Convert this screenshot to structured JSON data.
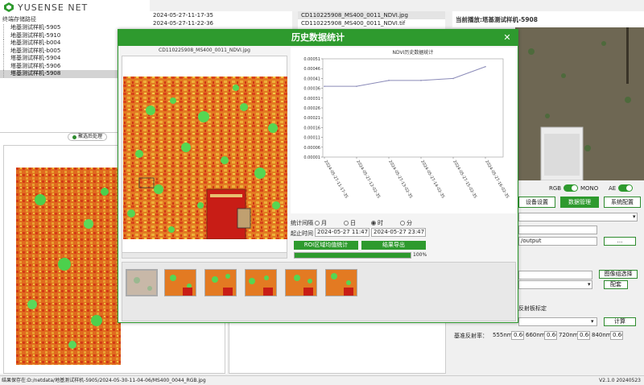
{
  "brand": {
    "name": "YUSENSE NET"
  },
  "tree": {
    "header": "终端存储路径",
    "items": [
      {
        "label": "地基测试样机-5905",
        "selected": false
      },
      {
        "label": "地基测试样机-5910",
        "selected": false
      },
      {
        "label": "地基测试样机-b004",
        "selected": false
      },
      {
        "label": "地基测试样机-b005",
        "selected": false
      },
      {
        "label": "塔基测试样机-5904",
        "selected": false
      },
      {
        "label": "塔基测试样机-5906",
        "selected": false
      },
      {
        "label": "塔基测试样机-5908",
        "selected": true
      }
    ]
  },
  "list1": {
    "items": [
      "2024-05-27-11-17-35",
      "2024-05-27-11-22-36"
    ]
  },
  "list2": {
    "items": [
      "CD110225908_MS400_0011_NDVI.jpg",
      "CD110225908_MS400_0011_NDVI.tif"
    ]
  },
  "badge": {
    "label": "聚选后处理"
  },
  "camera": {
    "title": "当前播放:塔基测试样机-5908"
  },
  "controls": {
    "rgb_label": "RGB",
    "mono_label": "MONO",
    "ae_label": "AE",
    "tab_device": "设备设置",
    "tab_data": "数据管理",
    "tab_system": "系统配置",
    "output_path": "/output",
    "browse": "...",
    "roi_select": "图像组选择",
    "config": "配套",
    "calib_label": "反射板标定",
    "calc": "计算",
    "reflect_label": "基准反射率：",
    "bands": [
      {
        "name": "555nm",
        "value": "0.60"
      },
      {
        "name": "660nm",
        "value": "0.60"
      },
      {
        "name": "720nm",
        "value": "0.60"
      },
      {
        "name": "840nm",
        "value": "0.60"
      }
    ]
  },
  "status": {
    "path": "结果保存在:D:/netdata/地基测试样机-5905/2024-05-30-11-04-06/MS400_0044_RGB.jpg",
    "version": "V2.1.0 20240523"
  },
  "dialog": {
    "title": "历史数据统计",
    "close": "✕",
    "image_caption": "CD110225908_MS400_0011_NDVI.jpg",
    "interval_label": "统计间隔",
    "opt_month": "月",
    "opt_day": "日",
    "opt_hour": "时",
    "opt_minute": "分",
    "selected_interval": "时",
    "time_label": "起止时间",
    "start_time": "2024-05-27 11:47:36",
    "end_time": "2024-05-27 23:47:36",
    "roi_button": "ROI区域均值统计",
    "export_button": "结果导出",
    "progress_pct": 100,
    "progress_label": "100%"
  },
  "chart_data": {
    "type": "line",
    "title": "NDVI历史数据统计",
    "x": [
      "2024-05-27-11-17-35",
      "2024-05-27-12-02-35",
      "2024-05-27-13-02-35",
      "2024-05-27-14-02-35",
      "2024-05-27-15-02-35",
      "2024-05-27-16-02-35"
    ],
    "values": [
      0.00037,
      0.00037,
      0.0004,
      0.0004,
      0.00041,
      0.00047
    ],
    "yticks": [
      "0.00001",
      "0.00006",
      "0.00011",
      "0.00016",
      "0.00021",
      "0.00026",
      "0.00031",
      "0.00036",
      "0.00041",
      "0.00046",
      "0.00051"
    ],
    "ylim": [
      1e-05,
      0.00051
    ],
    "grid": false,
    "color": "#8a8ab8"
  }
}
